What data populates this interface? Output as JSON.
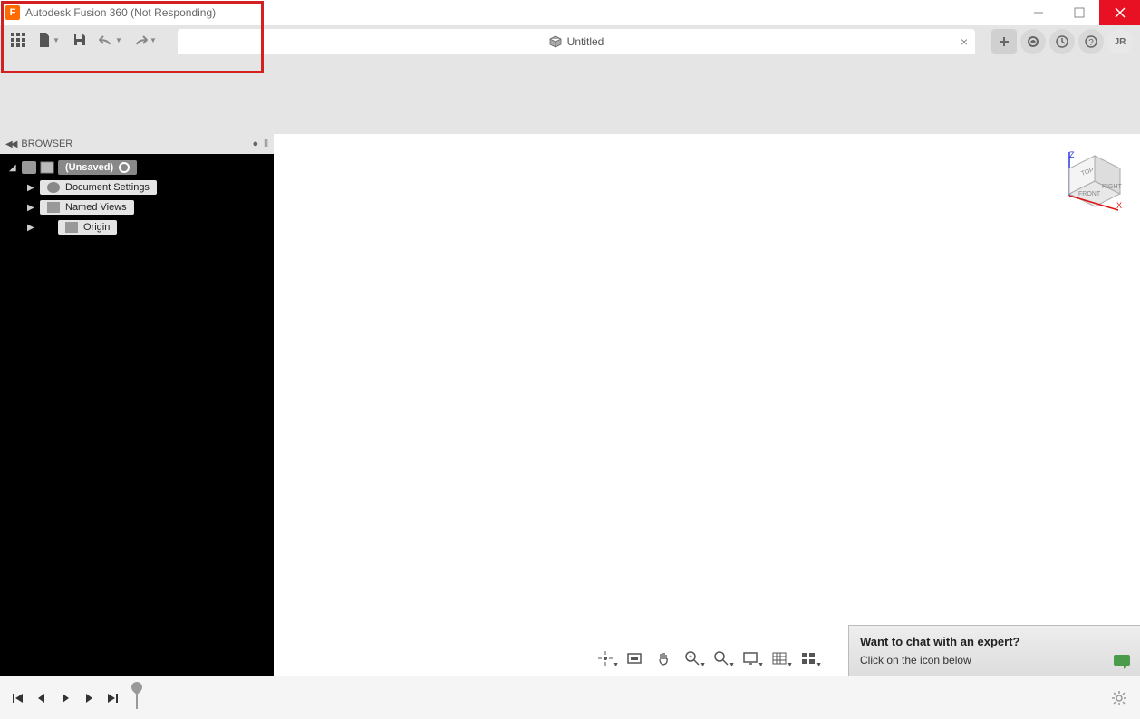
{
  "window": {
    "title": "Autodesk Fusion 360 (Not Responding)",
    "app_icon_letter": "F"
  },
  "tab": {
    "label": "Untitled"
  },
  "user": {
    "initials": "JR"
  },
  "browser": {
    "title": "BROWSER",
    "root": "(Unsaved)",
    "items": [
      {
        "label": "Document Settings"
      },
      {
        "label": "Named Views"
      },
      {
        "label": "Origin"
      }
    ]
  },
  "viewcube": {
    "top": "TOP",
    "front": "FRONT",
    "right": "RIGHT",
    "z": "Z",
    "x": "X"
  },
  "chat": {
    "title": "Want to chat with an expert?",
    "subtitle": "Click on the icon below"
  }
}
